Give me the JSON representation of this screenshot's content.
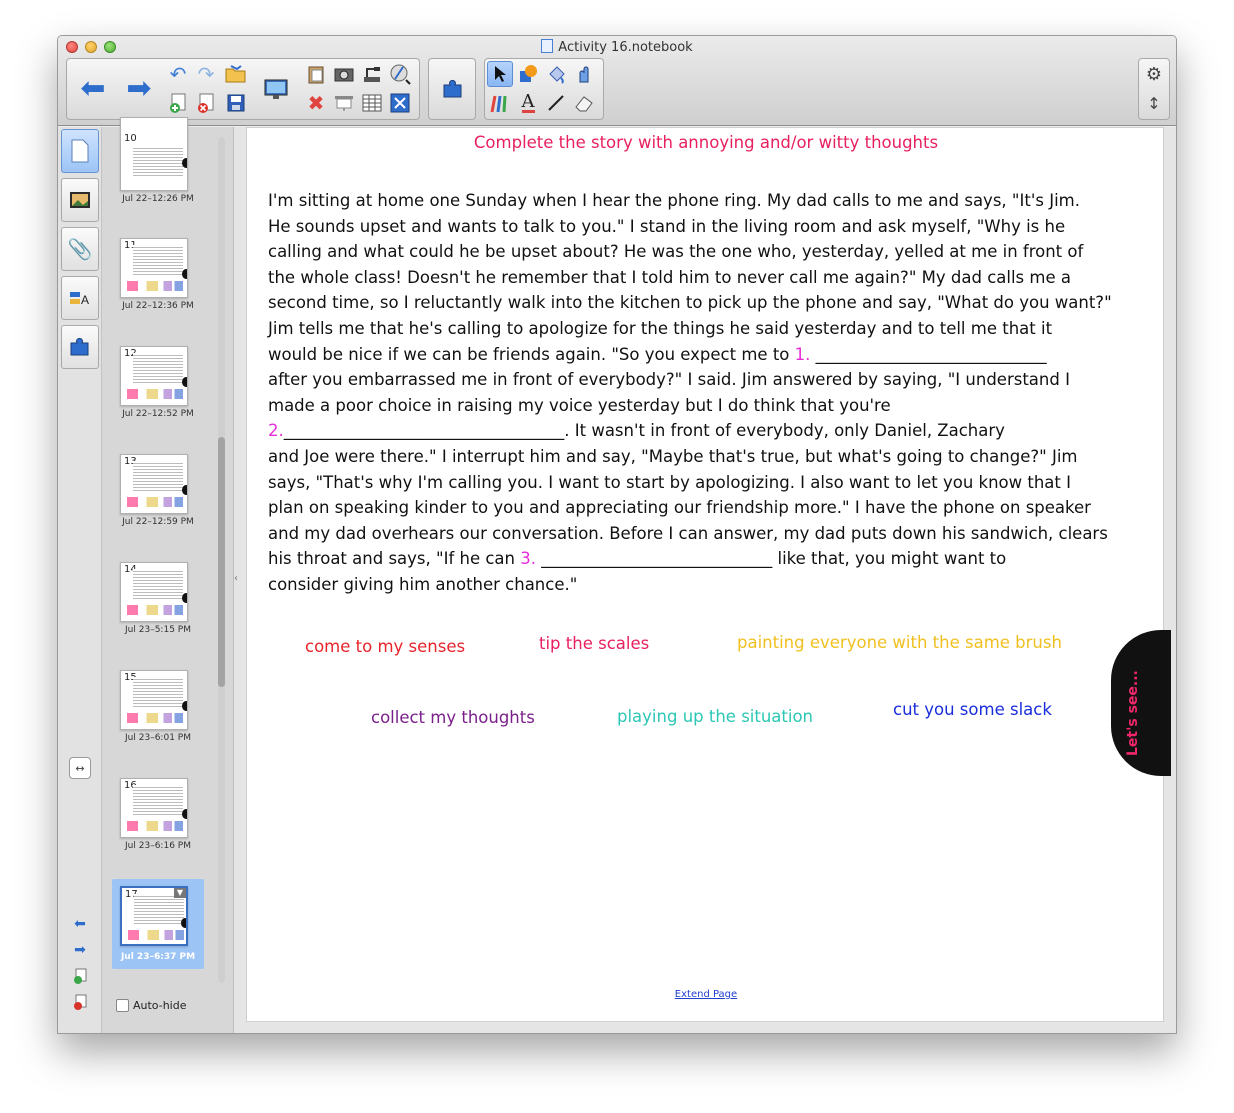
{
  "window": {
    "title": "Activity 16.notebook"
  },
  "toolbar": {
    "back_icon": "arrow-left-icon",
    "forward_icon": "arrow-right-icon",
    "settings_icon": "gear-icon",
    "expand_icon": "vertical-resize-icon"
  },
  "sidebar": {
    "tabs": [
      "page-sorter",
      "gallery",
      "attachments",
      "properties",
      "add-ons"
    ],
    "auto_hide_label": "Auto-hide",
    "thumbnails": [
      {
        "num": "10",
        "date": "Jul 22–12:26 PM"
      },
      {
        "num": "11",
        "date": "Jul 22–12:36 PM"
      },
      {
        "num": "12",
        "date": "Jul 22–12:52 PM"
      },
      {
        "num": "13",
        "date": "Jul 22–12:59 PM"
      },
      {
        "num": "14",
        "date": "Jul 23–5:15 PM"
      },
      {
        "num": "15",
        "date": "Jul 23–6:01 PM"
      },
      {
        "num": "16",
        "date": "Jul 23–6:16 PM"
      },
      {
        "num": "17",
        "date": "Jul 23–6:37 PM"
      }
    ]
  },
  "page": {
    "title": "Complete the story with annoying and/or witty thoughts",
    "story": {
      "p1": "I'm sitting at home one Sunday when I hear the phone ring.  My dad calls to me and says, \"It's Jim.\nHe sounds upset and wants to talk to you.\"  I stand in the living room and ask myself, \"Why is he\ncalling and what could he be upset about?  He was the one who, yesterday, yelled at me in front of\nthe whole class!  Doesn't he remember that I told him to never call me again?\"  My dad calls me a\nsecond time, so I reluctantly walk into the kitchen to pick up the phone and say, \"What do you want?\"\nJim tells me that he's calling to apologize for the things he said yesterday and to tell me that it\nwould be nice if we can be friends again.  \"So you expect me to ",
      "n1": "1.",
      "p2": " ____________________________\nafter you embarrassed me in front of everybody?\"  I said.  Jim answered by saying, \"I understand I\nmade a poor choice in raising my voice yesterday but I do think that you're\n",
      "n2": "2.",
      "p3": "__________________________________.  It wasn't in front of everybody, only Daniel, Zachary\nand Joe were there.\"  I interrupt him and say, \"Maybe that's true, but what's going to change?\"  Jim\nsays, \"That's why I'm calling you.  I want to start by apologizing.  I also want to let you know that I\nplan on speaking kinder to you and appreciating our friendship more.\"  I have the phone on speaker\nand my dad overhears our conversation.  Before I can answer, my dad puts down his sandwich, clears\nhis throat and says, \"If he can ",
      "n3": "3.",
      "p4": " ____________________________ like that, you might want to\nconsider giving him another chance.\""
    },
    "phrases": [
      {
        "text": "come to my senses",
        "color": "#e8232a"
      },
      {
        "text": "tip the scales",
        "color": "#e8205f"
      },
      {
        "text": "painting everyone with the same brush",
        "color": "#f0c020"
      },
      {
        "text": "collect my thoughts",
        "color": "#7a1f8a"
      },
      {
        "text": "playing up the situation",
        "color": "#2cc7b5"
      },
      {
        "text": "cut you some slack",
        "color": "#1a2ddb"
      }
    ],
    "lets_see": "Let's see...",
    "extend_page": "Extend Page"
  }
}
